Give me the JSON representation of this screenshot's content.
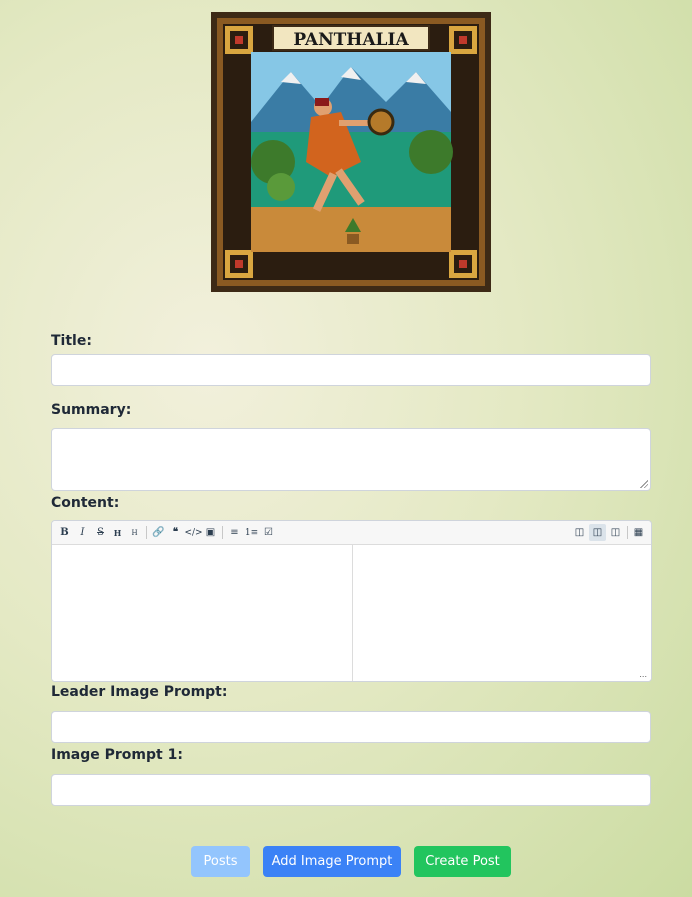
{
  "banner": {
    "title": "PANTHALIA",
    "icon": "pixel-art-banner"
  },
  "form": {
    "title_label": "Title:",
    "title_value": "",
    "summary_label": "Summary:",
    "summary_value": "",
    "content_label": "Content:",
    "leader_prompt_label": "Leader Image Prompt:",
    "leader_prompt_value": "",
    "image_prompt_1_label": "Image Prompt 1:",
    "image_prompt_1_value": ""
  },
  "editor": {
    "toolbar": [
      "bold-icon",
      "italic-icon",
      "strikethrough-icon",
      "heading-icon",
      "heading-smaller-icon",
      "link-icon",
      "quote-icon",
      "code-icon",
      "image-icon",
      "unordered-list-icon",
      "ordered-list-icon",
      "checklist-icon",
      "preview-icon",
      "side-by-side-icon",
      "fullscreen-preview-icon",
      "fullscreen-icon"
    ],
    "status_text": "..."
  },
  "buttons": {
    "posts": "Posts",
    "add_image_prompt": "Add Image Prompt",
    "create_post": "Create Post"
  },
  "colors": {
    "posts": "#93c5fd",
    "add_image_prompt": "#3b82f6",
    "create_post": "#22c55e"
  }
}
